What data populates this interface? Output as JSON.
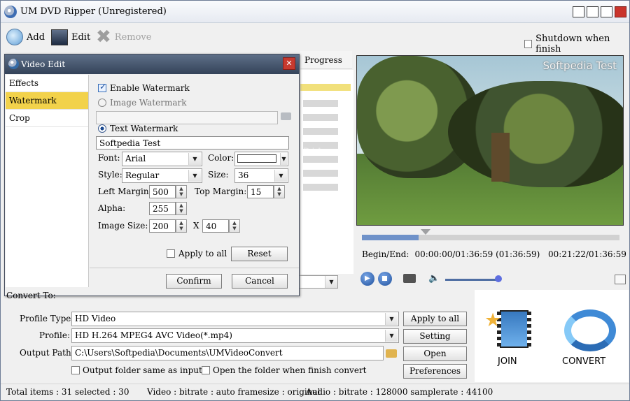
{
  "window": {
    "title": "UM DVD Ripper  (Unregistered)"
  },
  "toolbar": {
    "add": "Add",
    "edit": "Edit",
    "remove": "Remove",
    "shutdown": "Shutdown when finish"
  },
  "list": {
    "progress_header": "Progress"
  },
  "preview": {
    "watermark_text": "Softpedia Test",
    "ghost_text": "SOFTPEDIA",
    "seek_fraction": 0.22,
    "volume_fraction": 0.95,
    "begin_end_label": "Begin/End:",
    "begin_end_value": "00:00:00/01:36:59 (01:36:59)",
    "current_time": "00:21:22/01:36:59"
  },
  "dialog": {
    "title": "Video Edit",
    "tabs": [
      {
        "label": "Effects"
      },
      {
        "label": "Watermark"
      },
      {
        "label": "Crop"
      }
    ],
    "enable_watermark": "Enable Watermark",
    "image_watermark": "Image Watermark",
    "image_path": "",
    "text_watermark": "Text Watermark",
    "text_value": "Softpedia Test",
    "font_label": "Font:",
    "font_value": "Arial",
    "color_label": "Color:",
    "color_value": "#ffffff",
    "style_label": "Style:",
    "style_value": "Regular",
    "size_label": "Size:",
    "size_value": "36",
    "left_margin_label": "Left Margin:",
    "left_margin_value": "500",
    "top_margin_label": "Top Margin:",
    "top_margin_value": "15",
    "alpha_label": "Alpha:",
    "alpha_value": "255",
    "image_size_label": "Image Size:",
    "image_width": "200",
    "image_size_x": "X",
    "image_height": "40",
    "apply_all": "Apply to all",
    "reset": "Reset",
    "confirm": "Confirm",
    "cancel": "Cancel"
  },
  "convert": {
    "section_label": "Convert To:",
    "profile_type_label": "Profile Type:",
    "profile_type_value": "HD Video",
    "profile_label": "Profile:",
    "profile_value": "HD H.264 MPEG4 AVC Video(*.mp4)",
    "output_label": "Output Path:",
    "output_value": "C:\\Users\\Softpedia\\Documents\\UMVideoConvert",
    "same_folder": "Output folder same as input",
    "open_folder": "Open the folder when finish convert",
    "apply_all_button": "Apply to all",
    "setting_button": "Setting",
    "open_button": "Open",
    "preferences_button": "Preferences",
    "join_label": "JOIN",
    "convert_label": "CONVERT"
  },
  "status": {
    "items": "Total items : 31  selected : 30",
    "video": "Video : bitrate : auto framesize : original",
    "audio": "Audio : bitrate : 128000 samplerate : 44100"
  }
}
